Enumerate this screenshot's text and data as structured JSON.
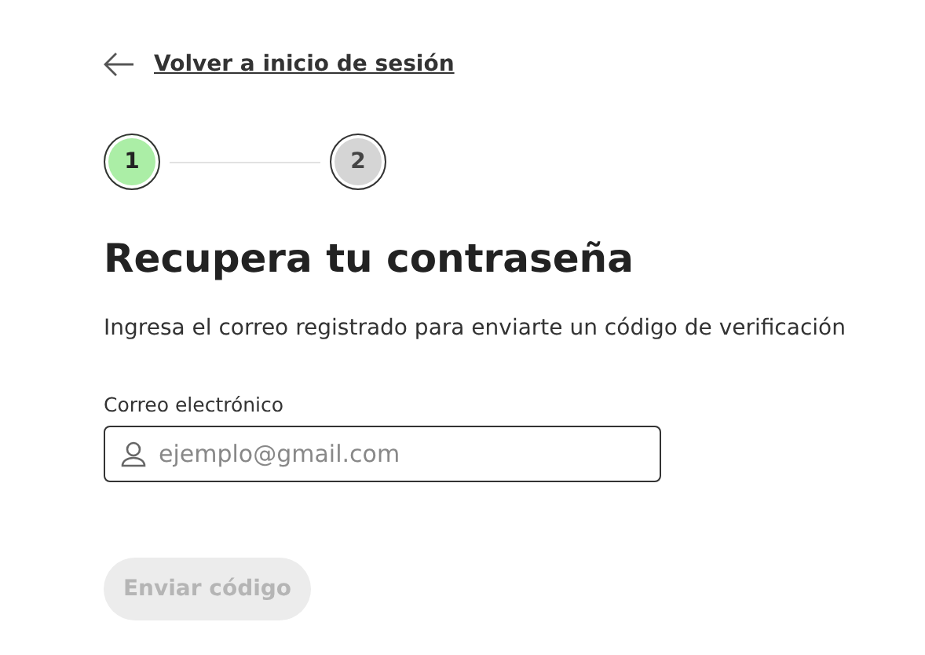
{
  "back_link": {
    "label": "Volver a inicio de sesión"
  },
  "steps": [
    {
      "label": "1",
      "selected": true
    },
    {
      "label": "2",
      "selected": false
    }
  ],
  "title": "Recupera tu contraseña",
  "subtitle": "Ingresa el correo registrado para enviarte un código de verificación",
  "email_field": {
    "label": "Correo electrónico",
    "placeholder": "ejemplo@gmail.com"
  },
  "submit_button": {
    "label": "Enviar código",
    "disabled": true
  }
}
